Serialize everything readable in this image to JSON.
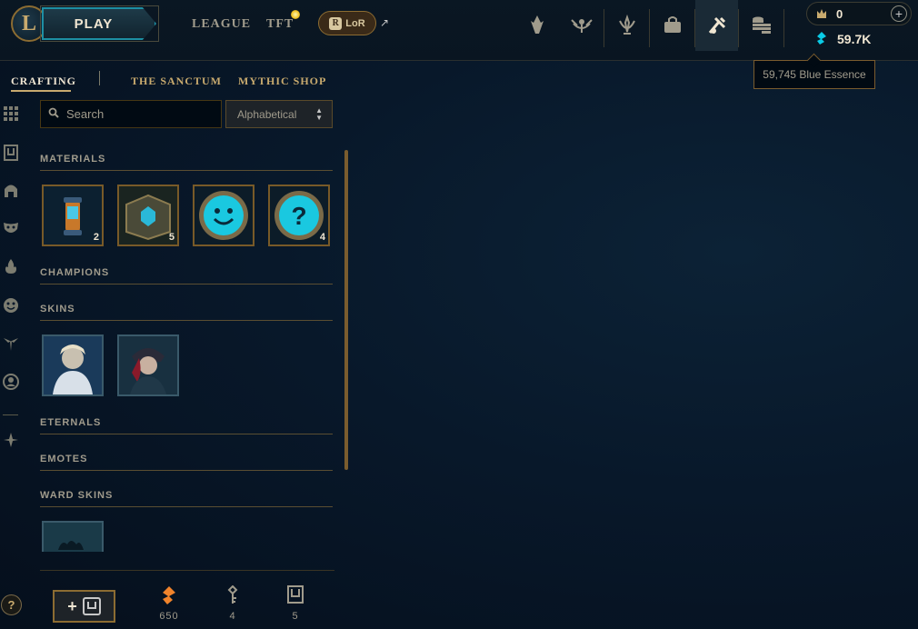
{
  "topbar": {
    "logo_letter": "L",
    "play_label": "PLAY",
    "nav": [
      {
        "label": "LEAGUE"
      },
      {
        "label": "TFT"
      }
    ],
    "lor_label": "LoR",
    "lor_letter": "R",
    "currency": {
      "rp_value": "0",
      "be_value": "59.7K",
      "be_tooltip": "59,745 Blue Essence"
    }
  },
  "subnav": {
    "tabs": [
      {
        "label": "CRAFTING"
      },
      {
        "label": "THE SANCTUM"
      },
      {
        "label": "MYTHIC SHOP"
      }
    ]
  },
  "toolbar": {
    "search_placeholder": "Search",
    "sort_value": "Alphabetical"
  },
  "sections": [
    {
      "title": "MATERIALS"
    },
    {
      "title": "CHAMPIONS"
    },
    {
      "title": "SKINS"
    },
    {
      "title": "ETERNALS"
    },
    {
      "title": "EMOTES"
    },
    {
      "title": "WARD SKINS"
    }
  ],
  "materials": [
    {
      "name": "capsule",
      "count": "2"
    },
    {
      "name": "hextech-chest",
      "count": "5"
    },
    {
      "name": "emote",
      "count": ""
    },
    {
      "name": "mystery-emote",
      "count": "4"
    }
  ],
  "skins": [
    {
      "name": "skin-1"
    },
    {
      "name": "skin-2"
    }
  ],
  "footer": {
    "add_label": "+",
    "stats": [
      {
        "icon": "orange-essence-icon",
        "value": "650"
      },
      {
        "icon": "key-fragment-icon",
        "value": "4"
      },
      {
        "icon": "chest-icon",
        "value": "5"
      }
    ]
  },
  "help_label": "?",
  "colors": {
    "gold": "#c8aa6e",
    "blue_essence": "#0acbe6",
    "orange_essence": "#f0832b",
    "background": "#08182a"
  }
}
